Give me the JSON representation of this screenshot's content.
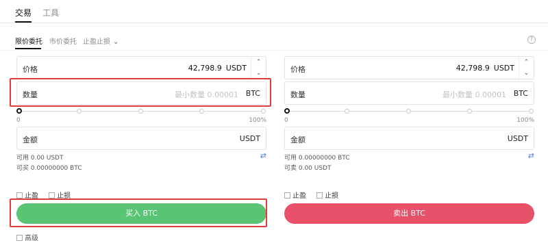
{
  "top_tabs": [
    "交易",
    "工具"
  ],
  "order_tabs": {
    "limit": "限价委托",
    "market": "市价委托",
    "stop": "止盈止损"
  },
  "buy": {
    "price_label": "价格",
    "price_value": "42,798.9",
    "price_unit": "USDT",
    "qty_label": "数量",
    "qty_placeholder": "最小数量 0.00001",
    "qty_unit": "BTC",
    "slider_min": "0",
    "slider_max": "100%",
    "amount_label": "金额",
    "amount_unit": "USDT",
    "available": "可用 0.00 USDT",
    "can_buy": "可买 0.00000000 BTC",
    "take_profit": "止盈",
    "stop_loss": "止损",
    "button": "买入 BTC"
  },
  "sell": {
    "price_label": "价格",
    "price_value": "42,798.9",
    "price_unit": "USDT",
    "qty_label": "数量",
    "qty_placeholder": "最小数量 0.00001",
    "qty_unit": "BTC",
    "slider_min": "0",
    "slider_max": "100%",
    "amount_label": "金额",
    "amount_unit": "USDT",
    "available": "可用 0.00000000 BTC",
    "can_sell": "可卖 0.00 USDT",
    "take_profit": "止盈",
    "stop_loss": "止损",
    "button": "卖出 BTC"
  },
  "bottom_partial": "高级",
  "colors": {
    "buy": "#59c474",
    "sell": "#e8516a",
    "highlight": "#e33b3b"
  }
}
